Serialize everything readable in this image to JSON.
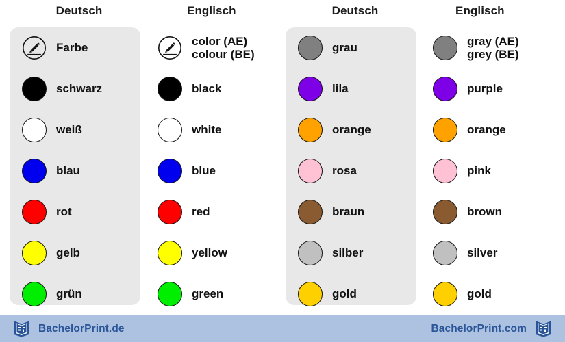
{
  "footer": {
    "bar_color": "#adc2e0",
    "brand_color": "#2a5699",
    "left_brand": "BachelorPrint.de",
    "right_brand": "BachelorPrint.com",
    "logo_icon": "bachelorprint-book-logo"
  },
  "panel_color": "#e8e8e8",
  "columns": [
    {
      "header": "Deutsch",
      "panel": true,
      "rows": [
        {
          "label": "Farbe",
          "icon": "pencil-icon",
          "swatch": null
        },
        {
          "label": "schwarz",
          "icon": "color-swatch",
          "swatch": "#000000"
        },
        {
          "label": "weiß",
          "icon": "color-swatch",
          "swatch": "#ffffff"
        },
        {
          "label": "blau",
          "icon": "color-swatch",
          "swatch": "#0000ee"
        },
        {
          "label": "rot",
          "icon": "color-swatch",
          "swatch": "#ff0000"
        },
        {
          "label": "gelb",
          "icon": "color-swatch",
          "swatch": "#ffff00"
        },
        {
          "label": "grün",
          "icon": "color-swatch",
          "swatch": "#00ee00"
        }
      ]
    },
    {
      "header": "Englisch",
      "panel": false,
      "rows": [
        {
          "label": "color (AE)\ncolour (BE)",
          "icon": "pencil-icon",
          "swatch": null
        },
        {
          "label": "black",
          "icon": "color-swatch",
          "swatch": "#000000"
        },
        {
          "label": "white",
          "icon": "color-swatch",
          "swatch": "#ffffff"
        },
        {
          "label": "blue",
          "icon": "color-swatch",
          "swatch": "#0000ee"
        },
        {
          "label": "red",
          "icon": "color-swatch",
          "swatch": "#ff0000"
        },
        {
          "label": "yellow",
          "icon": "color-swatch",
          "swatch": "#ffff00"
        },
        {
          "label": "green",
          "icon": "color-swatch",
          "swatch": "#00ee00"
        }
      ]
    },
    {
      "header": "Deutsch",
      "panel": true,
      "rows": [
        {
          "label": "grau",
          "icon": "color-swatch",
          "swatch": "#808080"
        },
        {
          "label": "lila",
          "icon": "color-swatch",
          "swatch": "#7d00e6"
        },
        {
          "label": "orange",
          "icon": "color-swatch",
          "swatch": "#ffa200"
        },
        {
          "label": "rosa",
          "icon": "color-swatch",
          "swatch": "#ffc2d4"
        },
        {
          "label": "braun",
          "icon": "color-swatch",
          "swatch": "#8a5a30"
        },
        {
          "label": "silber",
          "icon": "color-swatch",
          "swatch": "#c0c0c0"
        },
        {
          "label": "gold",
          "icon": "color-swatch",
          "swatch": "#ffd000"
        }
      ]
    },
    {
      "header": "Englisch",
      "panel": false,
      "rows": [
        {
          "label": "gray (AE)\ngrey (BE)",
          "icon": "color-swatch",
          "swatch": "#808080"
        },
        {
          "label": "purple",
          "icon": "color-swatch",
          "swatch": "#7d00e6"
        },
        {
          "label": "orange",
          "icon": "color-swatch",
          "swatch": "#ffa200"
        },
        {
          "label": "pink",
          "icon": "color-swatch",
          "swatch": "#ffc2d4"
        },
        {
          "label": "brown",
          "icon": "color-swatch",
          "swatch": "#8a5a30"
        },
        {
          "label": "silver",
          "icon": "color-swatch",
          "swatch": "#c0c0c0"
        },
        {
          "label": "gold",
          "icon": "color-swatch",
          "swatch": "#ffd000"
        }
      ]
    }
  ]
}
